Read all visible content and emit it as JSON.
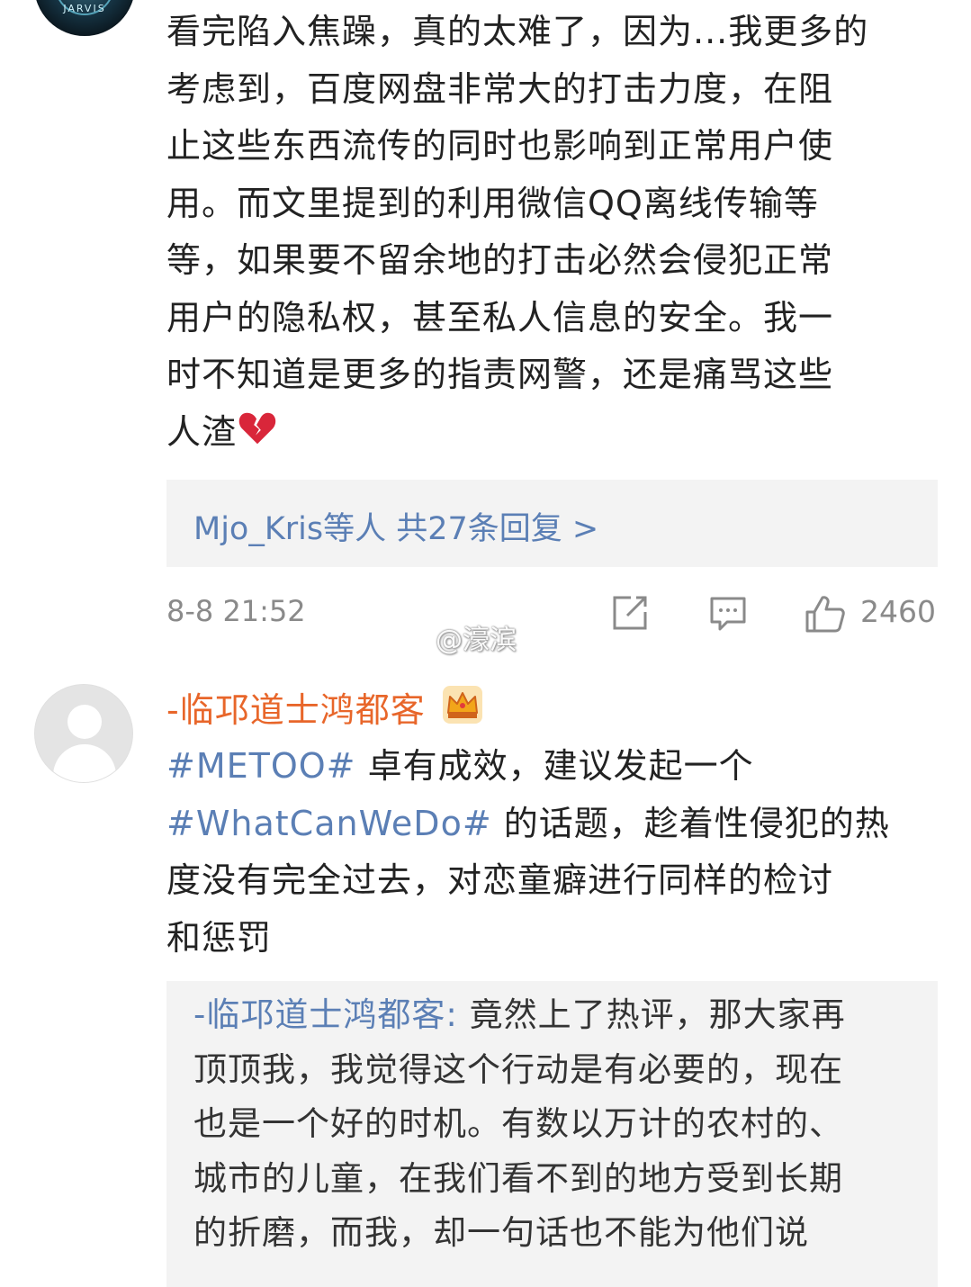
{
  "comment1": {
    "avatar_label": "JARVIS",
    "text": "看完陷入焦躁，真的太难了，因为...我更多的\n考虑到，百度网盘非常大的打击力度，在阻\n止这些东西流传的同时也影响到正常用户使\n用。而文里提到的利用微信QQ离线传输等\n等，如果要不留余地的打击必然会侵犯正常\n用户的隐私权，甚至私人信息的安全。我一\n时不知道是更多的指责网警，还是痛骂这些\n人渣",
    "emoji": "broken-heart-icon",
    "reply_summary": "Mjo_Kris等人  共27条回复 >",
    "time": "8-8 21:52",
    "like_count": "2460"
  },
  "watermark": "@濠滨",
  "comment2": {
    "username": "-临邛道士鸿都客",
    "badge": "crown-icon",
    "topic1": "#METOO#",
    "text1": " 卓有成效，建议发起一个",
    "topic2": "#WhatCanWeDo#",
    "text2": " 的话题，趁着性侵犯的热\n度没有完全过去，对恋童癖进行同样的检讨\n和惩罚",
    "quote_name": "-临邛道士鸿都客:",
    "quote_text": " 竟然上了热评，那大家再\n顶顶我，我觉得这个行动是有必要的，现在\n也是一个好的时机。有数以万计的农村的、\n城市的儿童，在我们看不到的地方受到长期\n的折磨，而我，却一句话也不能为他们说"
  },
  "colors": {
    "link": "#5b7fb5",
    "username": "#e8662a",
    "meta": "#8a8a8a",
    "reply_bg": "#f3f3f3"
  }
}
